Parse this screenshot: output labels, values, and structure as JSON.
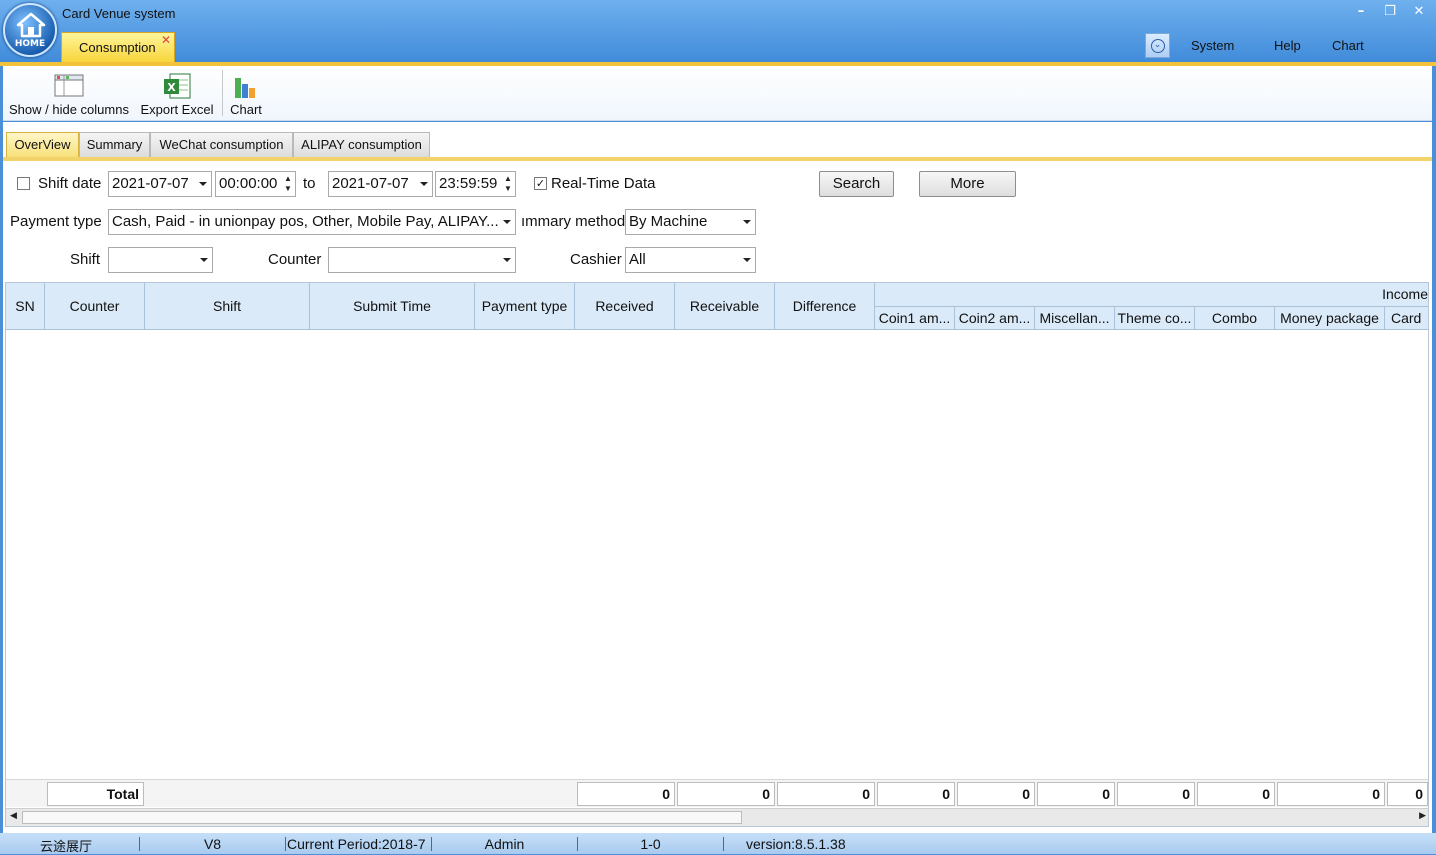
{
  "window": {
    "title": "Card Venue system",
    "home_label": "HOME",
    "min": "–",
    "max": "❐",
    "close": "✕"
  },
  "main_tab": {
    "label": "Consumption",
    "close": "✕"
  },
  "menu": {
    "items": [
      "System",
      "Help",
      "Chart"
    ]
  },
  "toolbar": {
    "show_hide": "Show / hide columns",
    "export": "Export Excel",
    "chart": "Chart"
  },
  "subtabs": [
    "OverView",
    "Summary",
    "WeChat consumption",
    "ALIPAY consumption"
  ],
  "filters": {
    "shift_date_label": "Shift date",
    "shift_date_checked": false,
    "from_date": "2021-07-07",
    "from_time": "00:00:00",
    "to_label": "to",
    "to_date": "2021-07-07",
    "to_time": "23:59:59",
    "realtime_label": "Real-Time Data",
    "realtime_checked": true,
    "search": "Search",
    "more": "More",
    "payment_type_label": "Payment type",
    "payment_type_value": "Cash, Paid - in unionpay pos, Other, Mobile Pay, ALIPAY...",
    "summary_method_label": "ımmary method",
    "summary_method_value": "By Machine",
    "shift_label": "Shift",
    "shift_value": "",
    "counter_label": "Counter",
    "counter_value": "",
    "cashier_label": "Cashier",
    "cashier_value": "All"
  },
  "grid": {
    "columns": [
      "SN",
      "Counter",
      "Shift",
      "Submit Time",
      "Payment type",
      "Received",
      "Receivable",
      "Difference"
    ],
    "income_group": "Income",
    "income_columns": [
      "Coin1 am...",
      "Coin2 am...",
      "Miscellan...",
      "Theme co...",
      "Combo",
      "Money package",
      "Card"
    ],
    "rows": [],
    "total_label": "Total",
    "totals": [
      "0",
      "0",
      "0",
      "0",
      "0",
      "0",
      "0",
      "0",
      "0",
      "0"
    ]
  },
  "status": {
    "venue": "云途展厅",
    "version_short": "V8",
    "period": "Current Period:2018-7",
    "user": "Admin",
    "code": "1-0",
    "version": "version:8.5.1.38"
  }
}
